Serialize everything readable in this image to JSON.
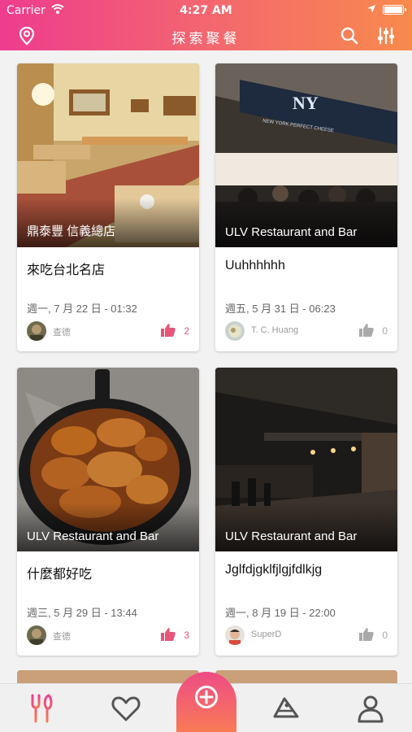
{
  "status_bar": {
    "carrier": "Carrier",
    "time": "4:27 AM"
  },
  "header": {
    "title": "探索聚餐",
    "icons": [
      "location-pin-icon",
      "search-icon",
      "filter-sliders-icon"
    ],
    "gradient": [
      "#ee3c8e",
      "#f88a4c"
    ]
  },
  "posts": [
    {
      "place": "鼎泰豐 信義總店",
      "title": "來吃台北名店",
      "date": "週一, 7 月 22 日 - 01:32",
      "author": "查德",
      "likes": "2",
      "liked": true
    },
    {
      "place": "ULV Restaurant and Bar",
      "title": "Uuhhhhhh",
      "date": "週五, 5 月 31 日 - 06:23",
      "author": "T. C. Huang",
      "likes": "0",
      "liked": false
    },
    {
      "place": "ULV Restaurant and Bar",
      "title": "什麼都好吃",
      "date": "週三, 5 月 29 日 - 13:44",
      "author": "查德",
      "likes": "3",
      "liked": true
    },
    {
      "place": "ULV Restaurant and Bar",
      "title": "Jglfdjgklfjlgjfdlkjg",
      "date": "週一, 8 月 19 日 - 22:00",
      "author": "SuperD",
      "likes": "0",
      "liked": false
    }
  ],
  "tabbar": {
    "tabs": [
      "dining-icon",
      "heart-icon",
      "add-icon",
      "cake-icon",
      "profile-icon"
    ],
    "active": "dining-icon",
    "accent": "#ee4c86"
  },
  "colors": {
    "like_active": "#e8557a",
    "like_inactive": "#aaaaaa"
  }
}
